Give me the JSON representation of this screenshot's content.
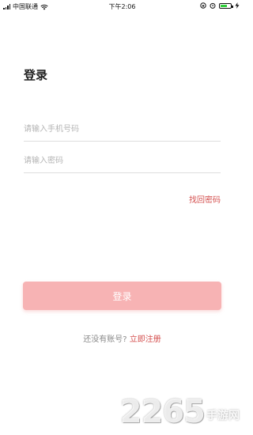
{
  "status_bar": {
    "carrier": "中国联通",
    "time": "下午2:06",
    "battery_level": 0.6,
    "colors": {
      "battery": "#2fcf3a"
    }
  },
  "login": {
    "title": "登录",
    "phone_placeholder": "请输入手机号码",
    "password_placeholder": "请输入密码",
    "forgot_label": "找回密码",
    "submit_label": "登录",
    "no_account_text": "还没有账号?",
    "register_link": "立即注册"
  },
  "watermark": {
    "number": "2265",
    "text": "手游网"
  },
  "colors": {
    "accent": "#d4504f",
    "button": "#f7b3b4"
  }
}
